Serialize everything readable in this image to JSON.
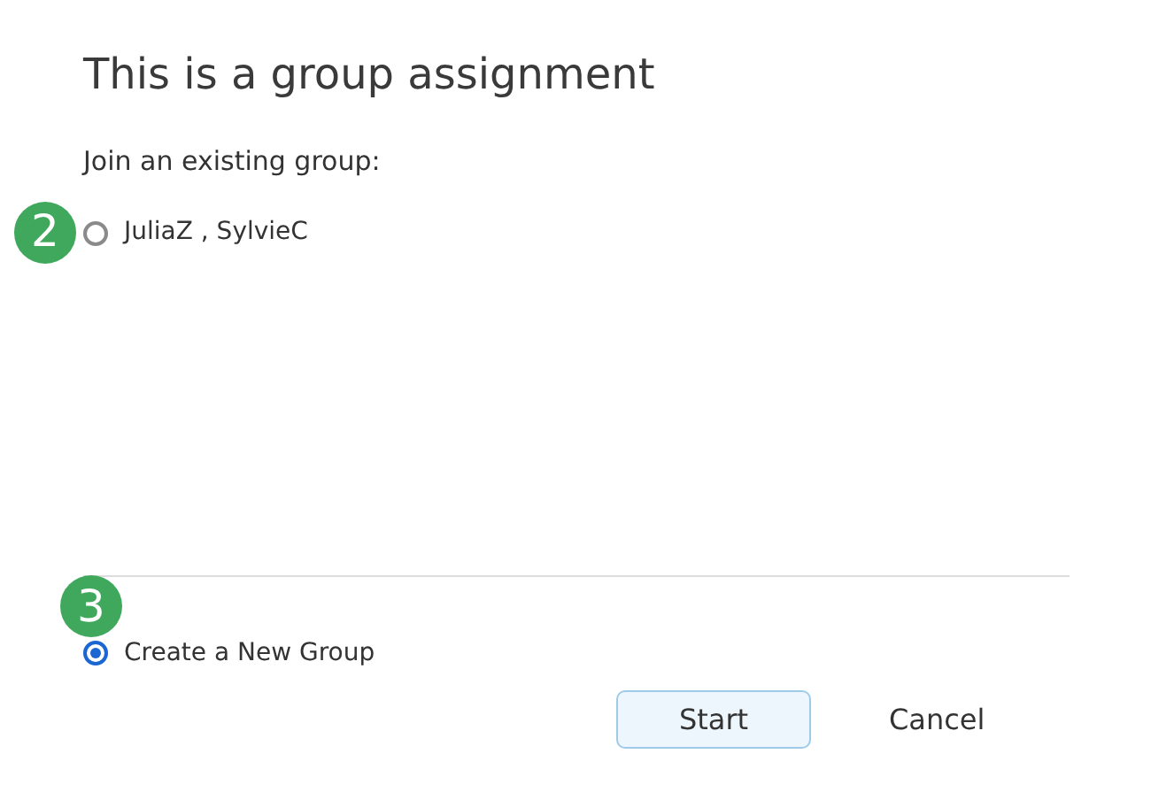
{
  "title": "This is a group assignment",
  "join_label": "Join an existing group:",
  "groups": [
    {
      "label": "JuliaZ , SylvieC",
      "selected": false,
      "step": "2"
    }
  ],
  "create": {
    "label": "Create a New Group",
    "selected": true,
    "step": "3"
  },
  "buttons": [
    {
      "label": "Start",
      "kind": "primary"
    },
    {
      "label": "Cancel",
      "kind": "plain"
    }
  ]
}
